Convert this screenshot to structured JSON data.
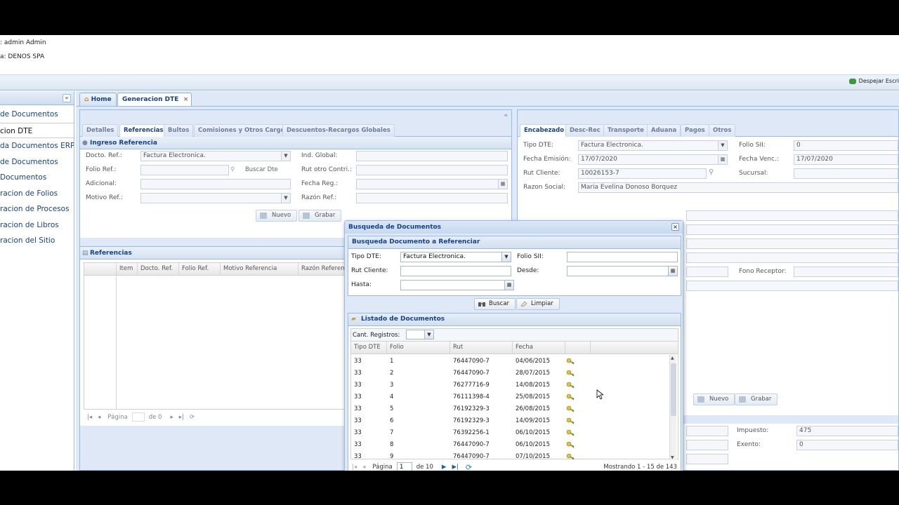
{
  "userbar": {
    "user_line": ": admin Admin",
    "company_line": "a: DENOS SPA"
  },
  "topbar": {
    "clear_label": "Despejar Escri"
  },
  "sidebar": {
    "items": [
      {
        "label": "de Documentos"
      },
      {
        "label": "cion DTE"
      },
      {
        "label": "da Documentos ERP"
      },
      {
        "label": "de Documentos"
      },
      {
        "label": "Documentos"
      },
      {
        "label": "racion de Folios"
      },
      {
        "label": "racion de Procesos"
      },
      {
        "label": "racion de Libros"
      },
      {
        "label": "racion del Sitio"
      }
    ]
  },
  "main_tabs": {
    "home": "Home",
    "generacion": "Generacion DTE"
  },
  "left_panel": {
    "subtabs": [
      "Detalles",
      "Referencias",
      "Bultos",
      "Comisiones y Otros Cargos",
      "Descuentos-Recargos Globales"
    ],
    "ingreso_title": "Ingreso Referencia",
    "labels": {
      "docto_ref": "Docto. Ref.:",
      "folio_ref": "Folio Ref.:",
      "adicional": "Adicional:",
      "motivo_ref": "Motivo Ref.:",
      "ind_global": "Ind. Global:",
      "rut_otro": "Rut otro Contri.:",
      "fecha_reg": "Fecha Reg.:",
      "razon_ref": "Razón Ref.:"
    },
    "docto_ref_value": "Factura Electronica.",
    "buscar_dte": "Buscar Dte",
    "nuevo": "Nuevo",
    "grabar": "Grabar",
    "referencias_title": "Referencias",
    "grid_cols": [
      "Item",
      "Docto. Ref.",
      "Folio Ref.",
      "Motivo Referencia",
      "Razón Referencia"
    ],
    "pager": {
      "pagina": "Página",
      "de": "de 0"
    }
  },
  "right_panel": {
    "subtabs": [
      "Encabezado",
      "Desc-Rec",
      "Transporte",
      "Aduana",
      "Pagos",
      "Otros"
    ],
    "labels": {
      "tipo_dte": "Tipo DTE:",
      "fecha_emision": "Fecha Emisión:",
      "rut_cliente": "Rut Cliente:",
      "razon_social": "Razon Social:",
      "folio_sii": "Folio SII:",
      "fecha_venc": "Fecha Venc.:",
      "sucursal": "Sucursal:",
      "fono_receptor": "Fono Receptor:",
      "impuesto": "Impuesto:",
      "exento": "Exento:"
    },
    "values": {
      "tipo_dte": "Factura Electronica.",
      "fecha_emision": "17/07/2020",
      "rut_cliente": "10026153-7",
      "razon_social": "Maria Evelina Donoso Borquez",
      "folio_sii": "0",
      "fecha_venc": "17/07/2020",
      "impuesto": "475",
      "exento": "0"
    },
    "nuevo": "Nuevo",
    "grabar": "Grabar"
  },
  "modal": {
    "title": "Busqueda de Documentos",
    "search_section": "Busqueda Documento a Referenciar",
    "labels": {
      "tipo_dte": "Tipo DTE:",
      "rut_cliente": "Rut Cliente:",
      "hasta": "Hasta:",
      "folio_sii": "Folio SII:",
      "desde": "Desde:"
    },
    "tipo_dte_value": "Factura Electronica.",
    "buscar": "Buscar",
    "limpiar": "Limpiar",
    "list_section": "Listado de Documentos",
    "cant_registros": "Cant. Registros:",
    "columns": [
      "Tipo DTE",
      "Folio",
      "Rut",
      "Fecha"
    ],
    "rows": [
      {
        "tipo": "33",
        "folio": "1",
        "rut": "76447090-7",
        "fecha": "04/06/2015"
      },
      {
        "tipo": "33",
        "folio": "2",
        "rut": "76447090-7",
        "fecha": "28/07/2015"
      },
      {
        "tipo": "33",
        "folio": "3",
        "rut": "76277716-9",
        "fecha": "14/08/2015"
      },
      {
        "tipo": "33",
        "folio": "4",
        "rut": "76111398-4",
        "fecha": "25/08/2015"
      },
      {
        "tipo": "33",
        "folio": "5",
        "rut": "76192329-3",
        "fecha": "26/08/2015"
      },
      {
        "tipo": "33",
        "folio": "6",
        "rut": "76192329-3",
        "fecha": "14/09/2015"
      },
      {
        "tipo": "33",
        "folio": "7",
        "rut": "76392256-1",
        "fecha": "06/10/2015"
      },
      {
        "tipo": "33",
        "folio": "8",
        "rut": "76447090-7",
        "fecha": "06/10/2015"
      },
      {
        "tipo": "33",
        "folio": "9",
        "rut": "76447090-7",
        "fecha": "07/10/2015"
      }
    ],
    "pager": {
      "pagina": "Página",
      "page": "1",
      "de": "de 10",
      "mostrando": "Mostrando 1 - 15 de 143"
    }
  },
  "colors": {
    "accent": "#15428b",
    "border": "#99bbe8",
    "panel_bg": "#dfe8f6"
  }
}
